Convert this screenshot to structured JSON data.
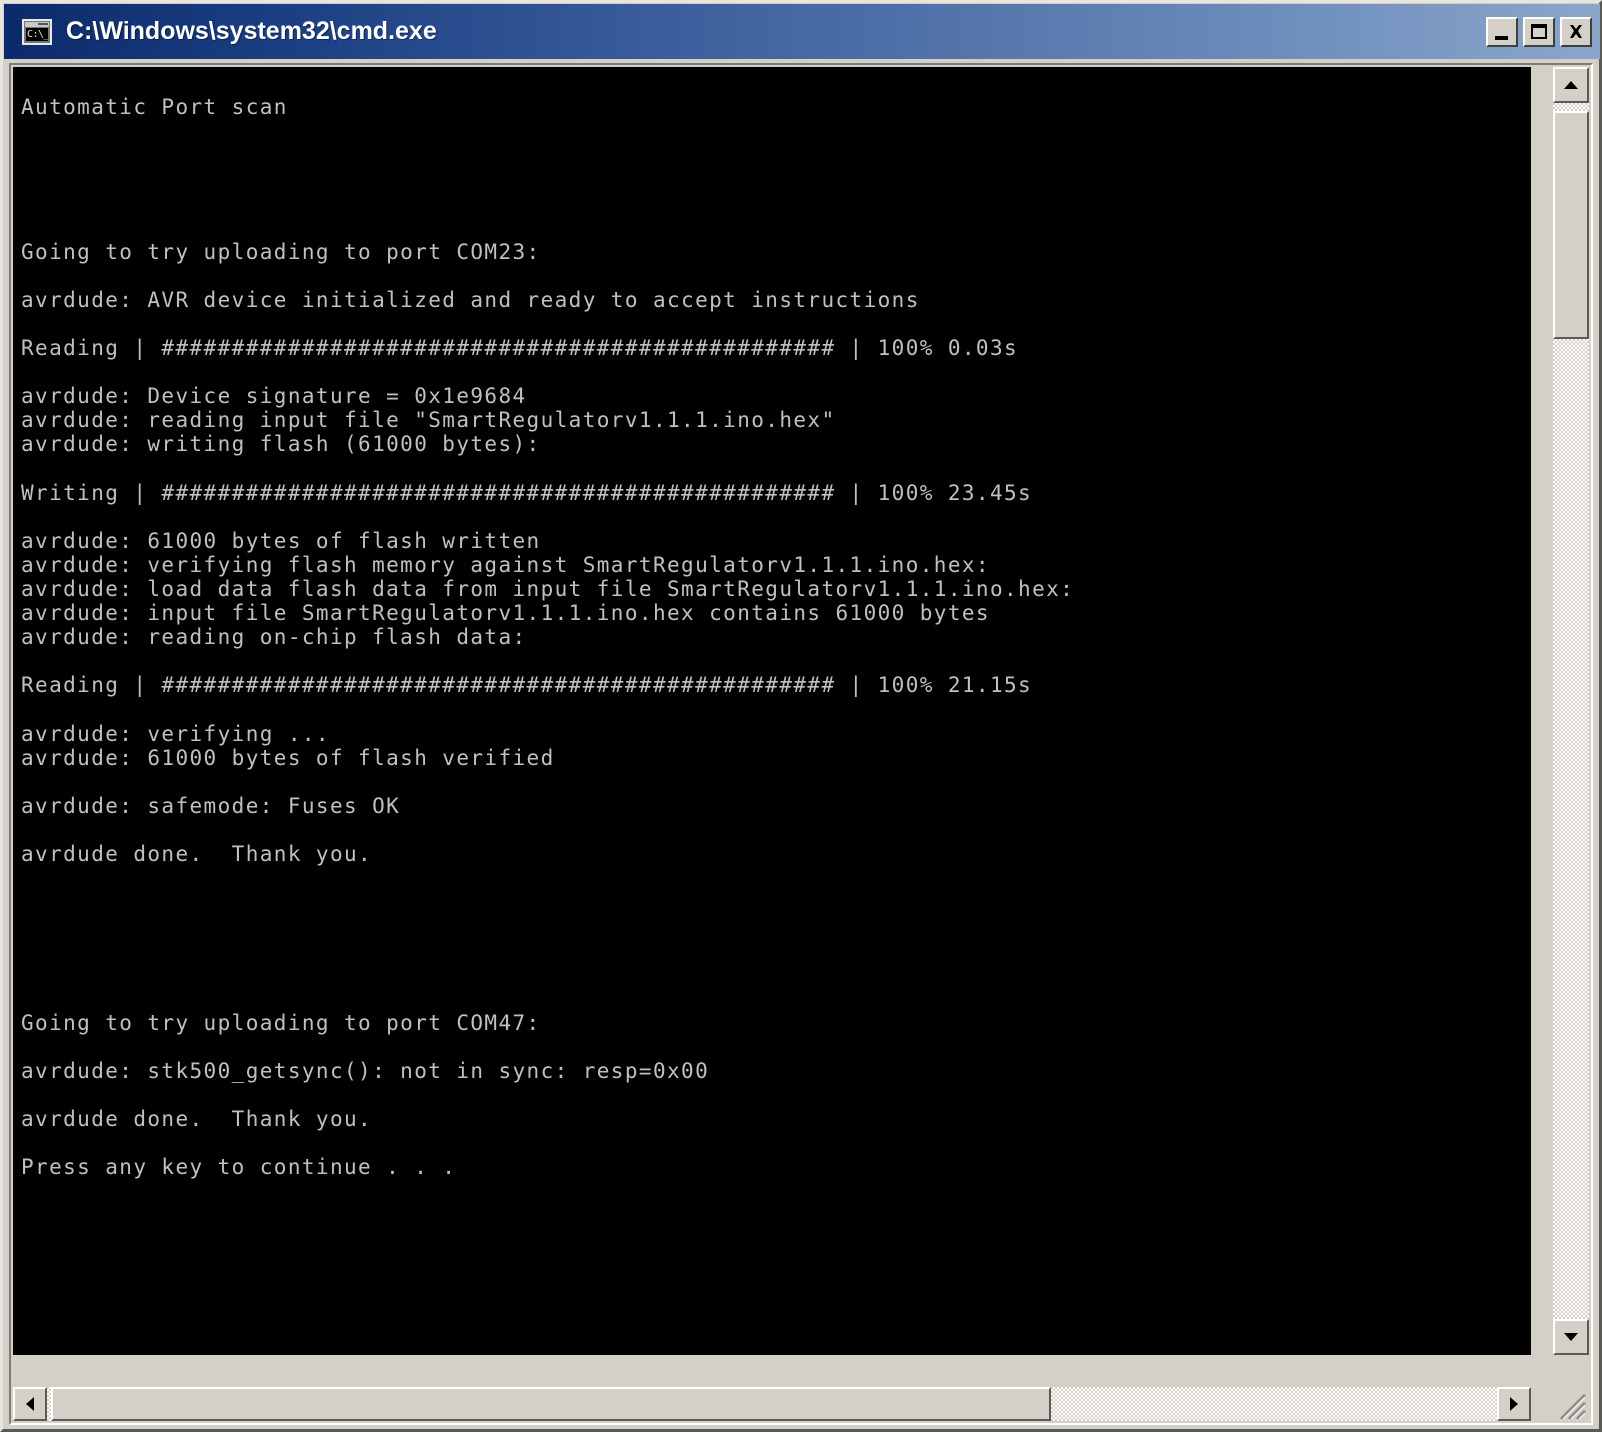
{
  "window": {
    "title": "C:\\Windows\\system32\\cmd.exe",
    "icon_name": "cmd-console-icon",
    "icon_glyph": "C:\\_",
    "titlebar_gradient_start": "#0b2a6b",
    "titlebar_gradient_end": "#8ba6cb",
    "face_color": "#d4d0c8"
  },
  "caption_buttons": {
    "minimize_label": "Minimize",
    "maximize_label": "Maximize",
    "close_label": "Close"
  },
  "console": {
    "background": "#000000",
    "foreground": "#c0c0c0",
    "text": "\nAutomatic Port scan\n\n\n\n\n\nGoing to try uploading to port COM23:\n\navrdude: AVR device initialized and ready to accept instructions\n\nReading | ################################################ | 100% 0.03s\n\navrdude: Device signature = 0x1e9684\navrdude: reading input file \"SmartRegulatorv1.1.1.ino.hex\"\navrdude: writing flash (61000 bytes):\n\nWriting | ################################################ | 100% 23.45s\n\navrdude: 61000 bytes of flash written\navrdude: verifying flash memory against SmartRegulatorv1.1.1.ino.hex:\navrdude: load data flash data from input file SmartRegulatorv1.1.1.ino.hex:\navrdude: input file SmartRegulatorv1.1.1.ino.hex contains 61000 bytes\navrdude: reading on-chip flash data:\n\nReading | ################################################ | 100% 21.15s\n\navrdude: verifying ...\navrdude: 61000 bytes of flash verified\n\navrdude: safemode: Fuses OK\n\navrdude done.  Thank you.\n\n\n\n\n\n\nGoing to try uploading to port COM47:\n\navrdude: stk500_getsync(): not in sync: resp=0x00\n\navrdude done.  Thank you.\n\nPress any key to continue . . ."
  },
  "console_lines": [
    "Automatic Port scan",
    "Going to try uploading to port COM23:",
    "avrdude: AVR device initialized and ready to accept instructions",
    "Reading | ################################################ | 100% 0.03s",
    "avrdude: Device signature = 0x1e9684",
    "avrdude: reading input file \"SmartRegulatorv1.1.1.ino.hex\"",
    "avrdude: writing flash (61000 bytes):",
    "Writing | ################################################ | 100% 23.45s",
    "avrdude: 61000 bytes of flash written",
    "avrdude: verifying flash memory against SmartRegulatorv1.1.1.ino.hex:",
    "avrdude: load data flash data from input file SmartRegulatorv1.1.1.ino.hex:",
    "avrdude: input file SmartRegulatorv1.1.1.ino.hex contains 61000 bytes",
    "avrdude: reading on-chip flash data:",
    "Reading | ################################################ | 100% 21.15s",
    "avrdude: verifying ...",
    "avrdude: 61000 bytes of flash verified",
    "avrdude: safemode: Fuses OK",
    "avrdude done.  Thank you.",
    "Going to try uploading to port COM47:",
    "avrdude: stk500_getsync(): not in sync: resp=0x00",
    "avrdude done.  Thank you.",
    "Press any key to continue . . ."
  ],
  "scrollbars": {
    "vertical": {
      "up_arrow_name": "scroll-up-arrow",
      "down_arrow_name": "scroll-down-arrow",
      "thumb_name": "vertical-scroll-thumb"
    },
    "horizontal": {
      "left_arrow_name": "scroll-left-arrow",
      "right_arrow_name": "scroll-right-arrow",
      "thumb_name": "horizontal-scroll-thumb"
    },
    "resize_grip_name": "resize-grip"
  }
}
